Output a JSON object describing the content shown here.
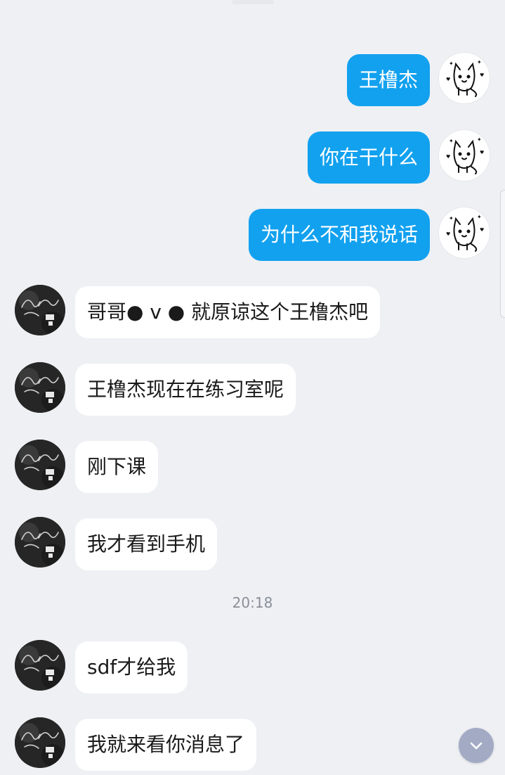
{
  "colors": {
    "background": "#eef0f4",
    "outgoing_bubble": "#12a1ef",
    "incoming_bubble": "#ffffff",
    "timestamp_text": "#8a8f98",
    "scroll_button": "#a3aac4"
  },
  "messages": [
    {
      "sender": "me",
      "text": "王橹杰"
    },
    {
      "sender": "me",
      "text": "你在干什么"
    },
    {
      "sender": "me",
      "text": "为什么不和我说话"
    },
    {
      "sender": "them",
      "text": "哥哥● v ● 就原谅这个王橹杰吧"
    },
    {
      "sender": "them",
      "text": "王橹杰现在在练习室呢"
    },
    {
      "sender": "them",
      "text": "刚下课"
    },
    {
      "sender": "them",
      "text": "我才看到手机"
    },
    {
      "sender": "them",
      "text": "sdf才给我"
    },
    {
      "sender": "them",
      "text": "我就来看你消息了"
    }
  ],
  "timestamp": "20:18",
  "icons": {
    "my_avatar": "cat-doodle-avatar-icon",
    "their_avatar": "dark-script-avatar-icon",
    "scroll_down": "chevron-down-icon"
  }
}
